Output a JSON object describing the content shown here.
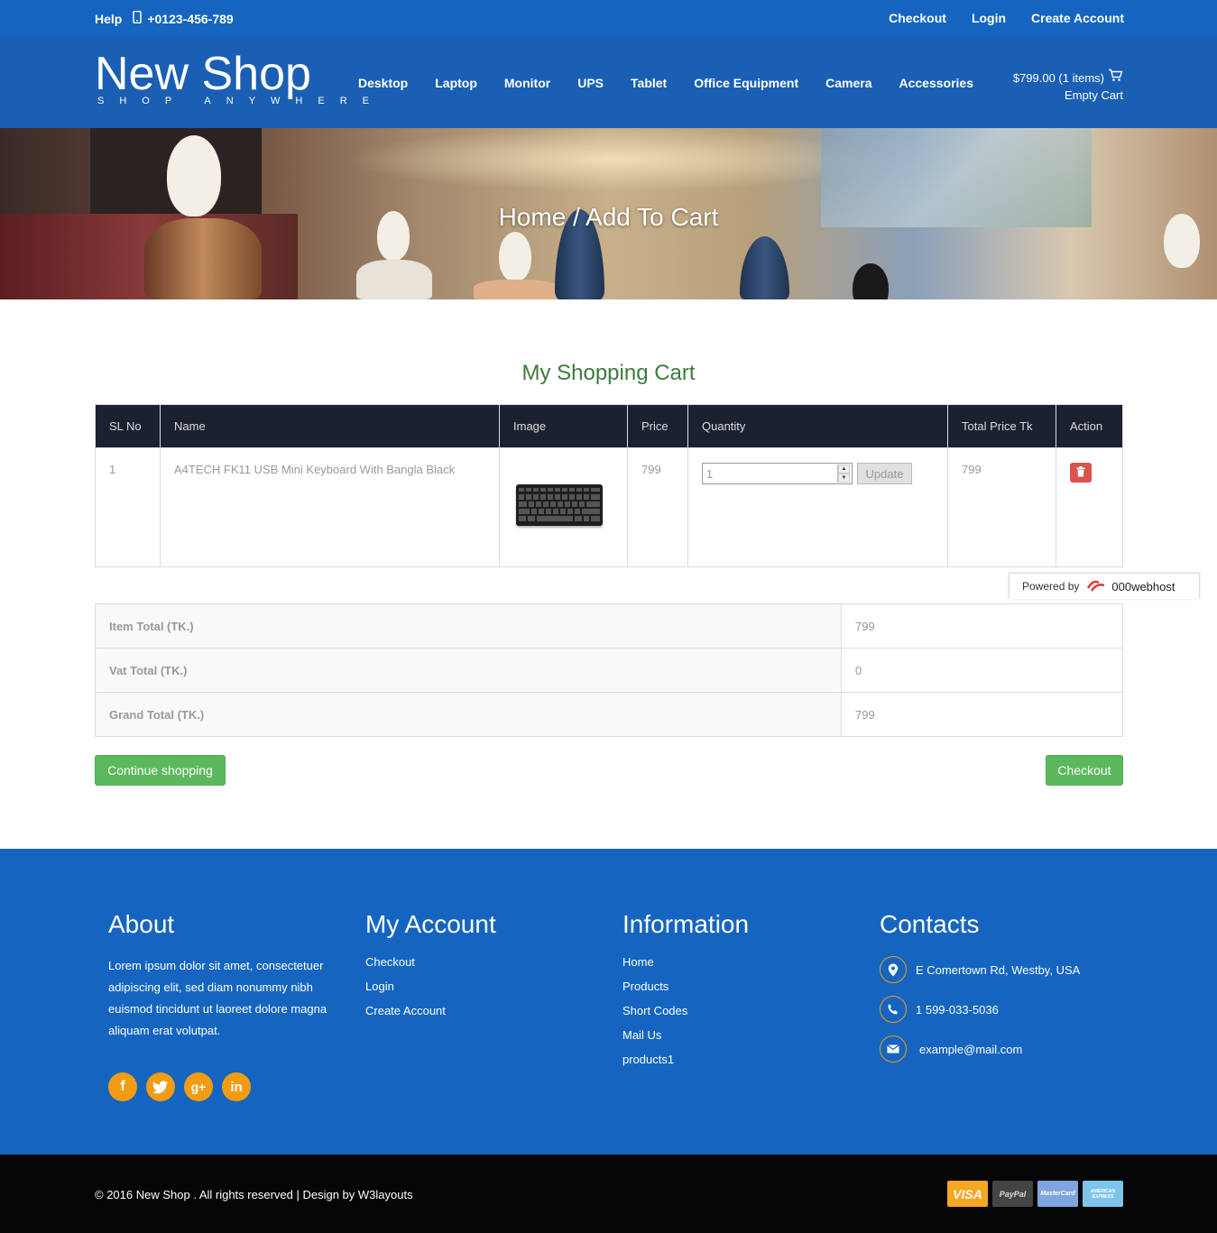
{
  "topbar": {
    "help": "Help",
    "phone": "+0123-456-789",
    "links": [
      "Checkout",
      "Login",
      "Create Account"
    ]
  },
  "header": {
    "logo_name": "New Shop",
    "logo_tagline": "SHOP ANYWHERE",
    "nav": [
      "Desktop",
      "Laptop",
      "Monitor",
      "UPS",
      "Tablet",
      "Office Equipment",
      "Camera",
      "Accessories"
    ],
    "cart_summary": "$799.00 (1 items)",
    "empty_cart": "Empty Cart"
  },
  "banner": {
    "breadcrumb": "Home / Add To Cart"
  },
  "cart": {
    "title": "My Shopping Cart",
    "columns": [
      "SL No",
      "Name",
      "Image",
      "Price",
      "Quantity",
      "Total Price Tk",
      "Action"
    ],
    "rows": [
      {
        "sl": "1",
        "name": "A4TECH FK11 USB Mini Keyboard With Bangla Black",
        "price": "799",
        "quantity": "1",
        "total": "799"
      }
    ],
    "update_label": "Update"
  },
  "powered": {
    "label": "Powered by",
    "brand": "000webhost"
  },
  "totals": {
    "item_total_label": "Item Total (TK.)",
    "item_total_value": "799",
    "vat_total_label": "Vat Total (TK.)",
    "vat_total_value": "0",
    "grand_total_label": "Grand Total (TK.)",
    "grand_total_value": "799"
  },
  "actions": {
    "continue_label": "Continue shopping",
    "checkout_label": "Checkout"
  },
  "footer": {
    "about_title": "About",
    "about_text": "Lorem ipsum dolor sit amet, consectetuer adipiscing elit, sed diam nonummy nibh euismod tincidunt ut laoreet dolore magna aliquam erat volutpat.",
    "account_title": "My Account",
    "account_links": [
      "Checkout",
      "Login",
      "Create Account"
    ],
    "info_title": "Information",
    "info_links": [
      "Home",
      "Products",
      "Short Codes",
      "Mail Us",
      "products1"
    ],
    "contacts_title": "Contacts",
    "address": "E Comertown Rd, Westby, USA",
    "phone": "1 599-033-5036",
    "email": "example@mail.com"
  },
  "bottom": {
    "copyright": "© 2016 New Shop . All rights reserved | Design by  W3layouts",
    "cards": [
      "VISA",
      "PayPal",
      "MasterCard",
      "AMERICAN EXPRESS"
    ]
  },
  "colors": {
    "topbar": "#1565c0",
    "header": "#1a5fb4",
    "title_green": "#3d7a3d",
    "button_green": "#5cb85c",
    "delete_red": "#d9534f",
    "social_orange": "#f39c12",
    "table_header": "#1b2130"
  }
}
